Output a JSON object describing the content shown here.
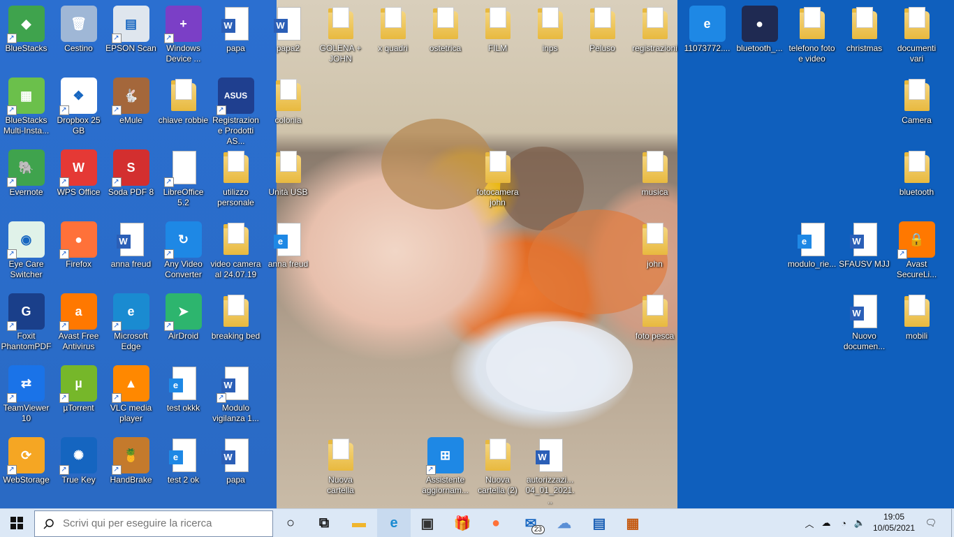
{
  "desktop": {
    "icons": [
      {
        "label": "BlueStacks",
        "kind": "app",
        "color": "#3fa34d",
        "glyph": "◆",
        "shortcut": true
      },
      {
        "label": "Cestino",
        "kind": "app",
        "color": "#9fb7d6",
        "glyph": "🗑",
        "shortcut": false
      },
      {
        "label": "EPSON Scan",
        "kind": "app",
        "color": "#dfe6ee",
        "glyph": "▤",
        "shortcut": true
      },
      {
        "label": "Windows Device ...",
        "kind": "app",
        "color": "#7b3fc6",
        "glyph": "+",
        "shortcut": true
      },
      {
        "label": "papa",
        "kind": "doc",
        "color": "#2b5fb7",
        "glyph": "W",
        "shortcut": false
      },
      {
        "label": "papa2",
        "kind": "doc",
        "color": "#2b5fb7",
        "glyph": "W",
        "shortcut": false
      },
      {
        "label": "GOLENA + JOHN",
        "kind": "folder",
        "color": "#e8b93f",
        "glyph": "",
        "shortcut": false
      },
      {
        "label": "x quadri",
        "kind": "folder",
        "color": "#e8b93f",
        "glyph": "",
        "shortcut": false
      },
      {
        "label": "ostetrica",
        "kind": "folder",
        "color": "#e8b93f",
        "glyph": "",
        "shortcut": false
      },
      {
        "label": "FILM",
        "kind": "folder",
        "color": "#e8b93f",
        "glyph": "",
        "shortcut": false
      },
      {
        "label": "inps",
        "kind": "folder",
        "color": "#e8b93f",
        "glyph": "",
        "shortcut": false
      },
      {
        "label": "Peluso",
        "kind": "folder",
        "color": "#e8b93f",
        "glyph": "",
        "shortcut": false
      },
      {
        "label": "registrazioni",
        "kind": "folder",
        "color": "#e8b93f",
        "glyph": "",
        "shortcut": false
      },
      {
        "label": "11073772....",
        "kind": "app",
        "color": "#1e88e5",
        "glyph": "e",
        "shortcut": false
      },
      {
        "label": "bluetooth_...",
        "kind": "app",
        "color": "#1f2a52",
        "glyph": "●",
        "shortcut": false
      },
      {
        "label": "telefono foto e video",
        "kind": "folder",
        "color": "#e8b93f",
        "glyph": "",
        "shortcut": false
      },
      {
        "label": "christmas",
        "kind": "folder",
        "color": "#e8b93f",
        "glyph": "",
        "shortcut": false
      },
      {
        "label": "documenti vari",
        "kind": "folder",
        "color": "#e8b93f",
        "glyph": "",
        "shortcut": false
      },
      {
        "label": "BlueStacks Multi-Insta...",
        "kind": "app",
        "color": "#6bc04b",
        "glyph": "▦",
        "shortcut": true
      },
      {
        "label": "Dropbox 25 GB",
        "kind": "app",
        "color": "#ffffff",
        "glyph": "❖",
        "shortcut": true
      },
      {
        "label": "eMule",
        "kind": "app",
        "color": "#a4673b",
        "glyph": "🐇",
        "shortcut": true
      },
      {
        "label": "chiave robbie",
        "kind": "folder",
        "color": "#e8b93f",
        "glyph": "",
        "shortcut": false
      },
      {
        "label": "Registrazione Prodotti AS...",
        "kind": "app",
        "color": "#1f3f8f",
        "glyph": "ASUS",
        "shortcut": true
      },
      {
        "label": "colonia",
        "kind": "folder",
        "color": "#e8b93f",
        "glyph": "",
        "shortcut": false
      },
      {
        "label": "Camera",
        "kind": "folder",
        "color": "#e8b93f",
        "glyph": "",
        "shortcut": false
      },
      {
        "label": "Evernote",
        "kind": "app",
        "color": "#3fa34d",
        "glyph": "🐘",
        "shortcut": true
      },
      {
        "label": "WPS Office",
        "kind": "app",
        "color": "#e53935",
        "glyph": "W",
        "shortcut": true
      },
      {
        "label": "Soda PDF 8",
        "kind": "app",
        "color": "#d32f2f",
        "glyph": "S",
        "shortcut": true
      },
      {
        "label": "LibreOffice 5.2",
        "kind": "doc",
        "color": "#e0e0e0",
        "glyph": "",
        "shortcut": true
      },
      {
        "label": "utilizzo personale",
        "kind": "folder",
        "color": "#e8b93f",
        "glyph": "",
        "shortcut": false
      },
      {
        "label": "Unità USB",
        "kind": "folder",
        "color": "#e8b93f",
        "glyph": "",
        "shortcut": false
      },
      {
        "label": "fotocamera john",
        "kind": "folder",
        "color": "#e8b93f",
        "glyph": "",
        "shortcut": false
      },
      {
        "label": "musica",
        "kind": "folder",
        "color": "#e8b93f",
        "glyph": "",
        "shortcut": false
      },
      {
        "label": "bluetooth",
        "kind": "folder",
        "color": "#e8b93f",
        "glyph": "",
        "shortcut": false
      },
      {
        "label": "Eye Care Switcher",
        "kind": "app",
        "color": "#e0f2e9",
        "glyph": "◉",
        "shortcut": true
      },
      {
        "label": "Firefox",
        "kind": "app",
        "color": "#ff7139",
        "glyph": "●",
        "shortcut": true
      },
      {
        "label": "anna freud",
        "kind": "doc",
        "color": "#2b5fb7",
        "glyph": "W",
        "shortcut": false
      },
      {
        "label": "Any Video Converter",
        "kind": "app",
        "color": "#1e88e5",
        "glyph": "↻",
        "shortcut": true
      },
      {
        "label": "video camera al 24.07.19",
        "kind": "folder",
        "color": "#e8b93f",
        "glyph": "",
        "shortcut": false
      },
      {
        "label": "anna freud",
        "kind": "doc",
        "color": "#1e88e5",
        "glyph": "e",
        "shortcut": false
      },
      {
        "label": "john",
        "kind": "folder",
        "color": "#e8b93f",
        "glyph": "",
        "shortcut": false
      },
      {
        "label": "modulo_rie...",
        "kind": "doc",
        "color": "#1e88e5",
        "glyph": "e",
        "shortcut": false
      },
      {
        "label": "SFAUSV MJJ",
        "kind": "doc",
        "color": "#2b5fb7",
        "glyph": "W",
        "shortcut": false
      },
      {
        "label": "Avast SecureLi...",
        "kind": "app",
        "color": "#ff7800",
        "glyph": "🔒",
        "shortcut": true
      },
      {
        "label": "Foxit PhantomPDF",
        "kind": "app",
        "color": "#1a3f8a",
        "glyph": "G",
        "shortcut": true
      },
      {
        "label": "Avast Free Antivirus",
        "kind": "app",
        "color": "#ff7800",
        "glyph": "a",
        "shortcut": true
      },
      {
        "label": "Microsoft Edge",
        "kind": "app",
        "color": "#1a8bd1",
        "glyph": "e",
        "shortcut": true
      },
      {
        "label": "AirDroid",
        "kind": "app",
        "color": "#2db56e",
        "glyph": "➤",
        "shortcut": true
      },
      {
        "label": "breaking bed",
        "kind": "folder",
        "color": "#e8b93f",
        "glyph": "",
        "shortcut": false
      },
      {
        "label": "foto pesca",
        "kind": "folder",
        "color": "#e8b93f",
        "glyph": "",
        "shortcut": false
      },
      {
        "label": "Nuovo documen...",
        "kind": "doc",
        "color": "#2b5fb7",
        "glyph": "W",
        "shortcut": false
      },
      {
        "label": "mobili",
        "kind": "folder",
        "color": "#e8b93f",
        "glyph": "",
        "shortcut": false
      },
      {
        "label": "TeamViewer 10",
        "kind": "app",
        "color": "#1a73e8",
        "glyph": "⇄",
        "shortcut": true
      },
      {
        "label": "µTorrent",
        "kind": "app",
        "color": "#76b72a",
        "glyph": "µ",
        "shortcut": true
      },
      {
        "label": "VLC media player",
        "kind": "app",
        "color": "#ff8800",
        "glyph": "▲",
        "shortcut": true
      },
      {
        "label": "test okkk",
        "kind": "doc",
        "color": "#1e88e5",
        "glyph": "e",
        "shortcut": false
      },
      {
        "label": "Modulo vigilanza 1...",
        "kind": "doc",
        "color": "#2b5fb7",
        "glyph": "W",
        "shortcut": true
      },
      {
        "label": "WebStorage",
        "kind": "app",
        "color": "#f5a623",
        "glyph": "⟳",
        "shortcut": true
      },
      {
        "label": "True Key",
        "kind": "app",
        "color": "#1565c0",
        "glyph": "✺",
        "shortcut": true
      },
      {
        "label": "HandBrake",
        "kind": "app",
        "color": "#c47a2c",
        "glyph": "🍍",
        "shortcut": true
      },
      {
        "label": "test 2 ok",
        "kind": "doc",
        "color": "#1e88e5",
        "glyph": "e",
        "shortcut": false
      },
      {
        "label": "papa",
        "kind": "doc",
        "color": "#2b5fb7",
        "glyph": "W",
        "shortcut": false
      },
      {
        "label": "Nuova cartella",
        "kind": "folder",
        "color": "#e8b93f",
        "glyph": "",
        "shortcut": false
      },
      {
        "label": "Assistente aggiornam...",
        "kind": "app",
        "color": "#1e88e5",
        "glyph": "⊞",
        "shortcut": true
      },
      {
        "label": "Nuova cartella (2)",
        "kind": "folder",
        "color": "#e8b93f",
        "glyph": "",
        "shortcut": false
      },
      {
        "label": "autorizzazi... 04_01_2021...",
        "kind": "doc",
        "color": "#2b5fb7",
        "glyph": "W",
        "shortcut": false
      }
    ]
  },
  "taskbar": {
    "search_placeholder": "Scrivi qui per eseguire la ricerca",
    "pinned": [
      {
        "name": "cortana-icon",
        "glyph": "○",
        "color": "#111111"
      },
      {
        "name": "task-view-icon",
        "glyph": "⧉",
        "color": "#111111"
      },
      {
        "name": "file-explorer-icon",
        "glyph": "▬",
        "color": "#f0b52d"
      },
      {
        "name": "edge-icon",
        "glyph": "e",
        "color": "#1a8bd1"
      },
      {
        "name": "store-icon",
        "glyph": "▣",
        "color": "#333333"
      },
      {
        "name": "gift-icon",
        "glyph": "🎁",
        "color": "#d32f2f"
      },
      {
        "name": "firefox-icon",
        "glyph": "●",
        "color": "#ff7139"
      },
      {
        "name": "mail-icon",
        "glyph": "✉",
        "color": "#1565c0"
      },
      {
        "name": "nuvola-icon",
        "glyph": "☁",
        "color": "#5a8fd6"
      },
      {
        "name": "document-viewer-icon",
        "glyph": "▤",
        "color": "#1a5fb5"
      },
      {
        "name": "notepad-icon",
        "glyph": "▦",
        "color": "#c55a11"
      }
    ],
    "mail_badge": "23",
    "time": "19:05",
    "date": "10/05/2021"
  }
}
